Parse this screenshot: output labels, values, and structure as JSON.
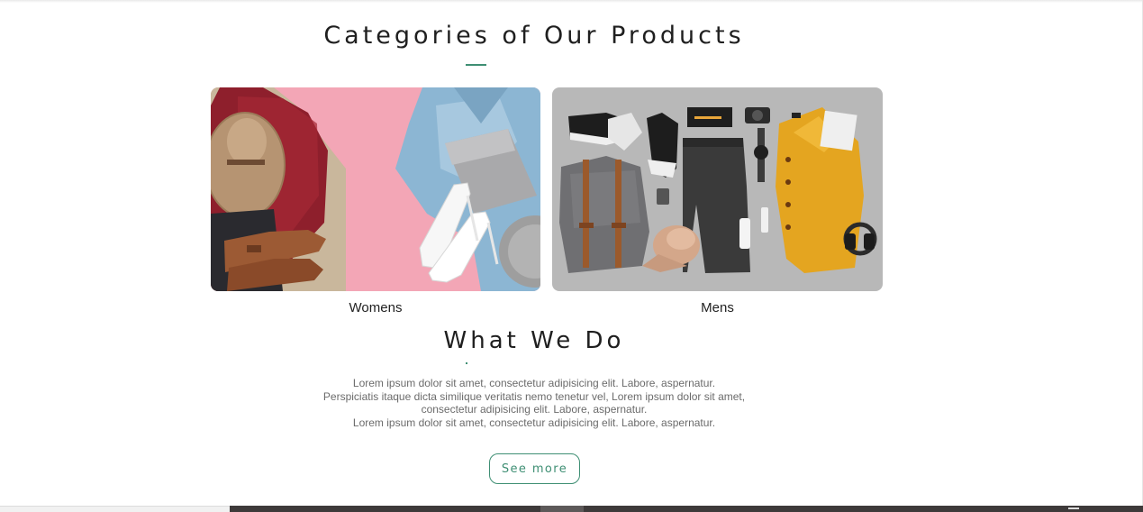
{
  "categories": {
    "title": "Categories of Our Products",
    "items": [
      {
        "label": "Womens"
      },
      {
        "label": "Mens"
      }
    ]
  },
  "about": {
    "title": "What We Do",
    "lines": [
      "Lorem ipsum dolor sit amet, consectetur adipisicing elit. Labore, aspernatur.",
      "Perspiciatis itaque dicta similique veritatis nemo tenetur vel, Lorem ipsum dolor sit amet,",
      "consectetur adipisicing elit. Labore, aspernatur.",
      "Lorem ipsum dolor sit amet, consectetur adipisicing elit. Labore, aspernatur."
    ],
    "button_label": "See more"
  },
  "colors": {
    "accent": "#3f8f74",
    "heading": "#1f1f1f",
    "body_text": "#6b6b6b",
    "womens_background": "#f3a6b6",
    "mens_background": "#b8b8b8",
    "footer_bar": "#3e3a3a"
  }
}
